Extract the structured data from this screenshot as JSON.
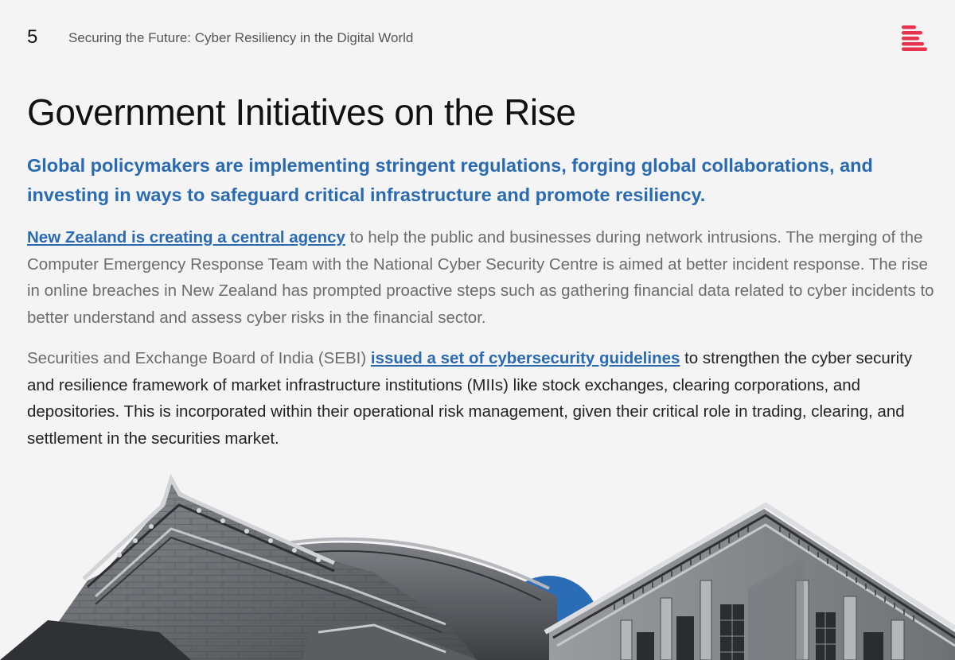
{
  "header": {
    "page_number": "5",
    "title": "Securing the Future: Cyber Resiliency in the Digital World",
    "logo_icon": "stacked-lines-logo",
    "accent_color": "#e8334f"
  },
  "main": {
    "title": "Government Initiatives on the Rise",
    "lead": "Global policymakers are implementing stringent regulations, forging global collaborations, and investing in ways to safeguard critical infrastructure and promote resiliency.",
    "paragraph1": {
      "link": "New Zealand is creating a central agency",
      "text": " to help the public and businesses during network intrusions. The merging of the Computer Emergency Response Team with the National Cyber Security Centre is aimed at better incident response. The rise in online breaches in New Zealand has prompted proactive steps such as gathering financial data related to cyber incidents to better understand and assess cyber risks in the financial sector."
    },
    "paragraph2": {
      "prefix": "Securities and Exchange Board of India (SEBI) ",
      "link": "issued a set of cybersecurity guidelines",
      "text": " to strengthen the cyber security and resilience framework of market infrastructure institutions (MIIs) like stock exchanges, clearing corporations, and depositories. This is incorporated within their operational risk management, given their critical role in trading, clearing, and settlement in the securities market."
    }
  },
  "colors": {
    "link": "#2a6ab3",
    "circle_accent": "#2b6cb6"
  }
}
